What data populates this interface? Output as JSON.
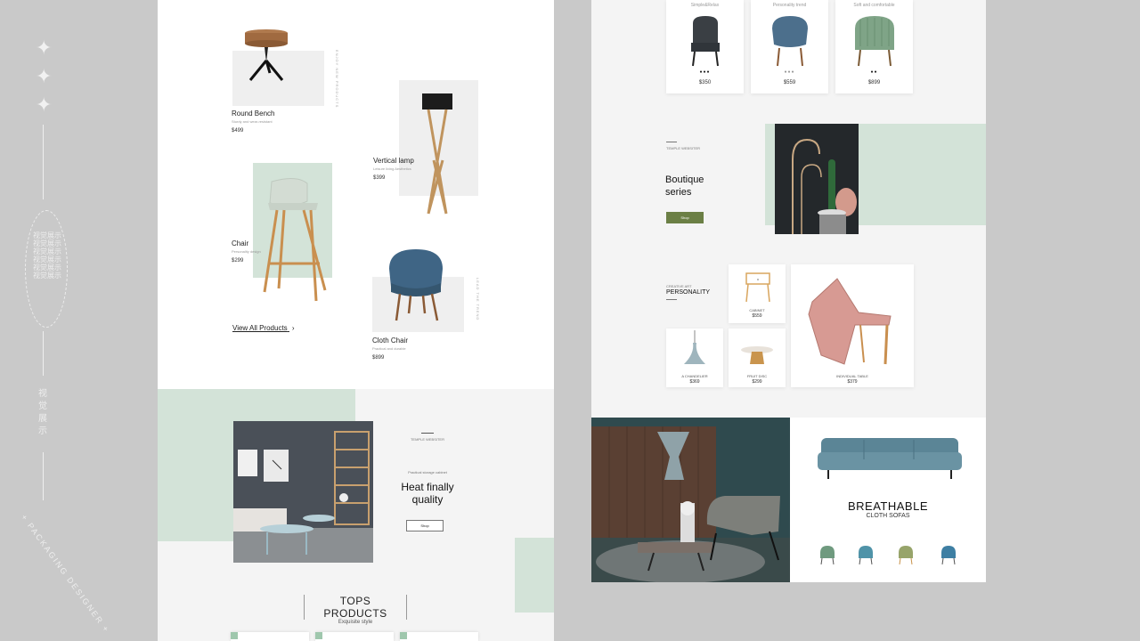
{
  "left_deco": {
    "vertical_chars": "视觉展示视觉展示视觉展示视觉展示视觉展示视觉展示",
    "title_chars": "视觉展示",
    "arc_text": "+ PACKAGING DESIGNER +"
  },
  "page1": {
    "products": [
      {
        "name": "Round Bench",
        "sub": "Sturdy and wear-resistant",
        "price": "$499"
      },
      {
        "name": "Vertical lamp",
        "sub": "Leisure living Aesthetics",
        "price": "$399"
      },
      {
        "name": "Chair",
        "sub": "Personality design",
        "price": "$299"
      },
      {
        "name": "Cloth Chair",
        "sub": "Practical and durable",
        "price": "$899"
      }
    ],
    "side_label_1": "ENJOY NEW PRODUCTS",
    "side_label_2": "LEAD THE TREND",
    "view_all": "View All Products",
    "view_all_arrow": "›",
    "feature": {
      "tag": "TEMPLE WEBSITER",
      "sub": "Practical storage cabinet",
      "title_1": "Heat finally",
      "title_2": "quality",
      "button": "Shop"
    },
    "tops": {
      "title": "TOPS PRODUCTS",
      "sub": "Exquisite style"
    }
  },
  "page2": {
    "top_cards": [
      {
        "cap": "Simple&Relax",
        "price": "$350",
        "color": "#3a3f44"
      },
      {
        "cap": "Personality trend",
        "price": "$559",
        "color": "#4c6f8c"
      },
      {
        "cap": "Soft and comfortable",
        "price": "$899",
        "color": "#7fa487"
      }
    ],
    "boutique": {
      "tag": "TEMPLE WEBSITER",
      "title_1": "Boutique",
      "title_2": "series",
      "button": "Shop"
    },
    "personality": {
      "tag": "CREATIVE ART",
      "title": "PERSONALITY",
      "items": [
        {
          "label": "CABINET",
          "price": "$559"
        },
        {
          "label": "A CHANDELIER",
          "price": "$369"
        },
        {
          "label": "FRUIT DISC",
          "price": "$299"
        },
        {
          "label": "INDIVIDUAL TABLE",
          "price": "$379"
        }
      ]
    },
    "sofa": {
      "title": "BREATHABLE",
      "sub": "CLOTH SOFAS"
    }
  },
  "colors": {
    "mint": "#d3e3d8",
    "olive": "#6b7f45",
    "teal": "#2f4a4e",
    "page_bg": "#c9c9c9"
  }
}
